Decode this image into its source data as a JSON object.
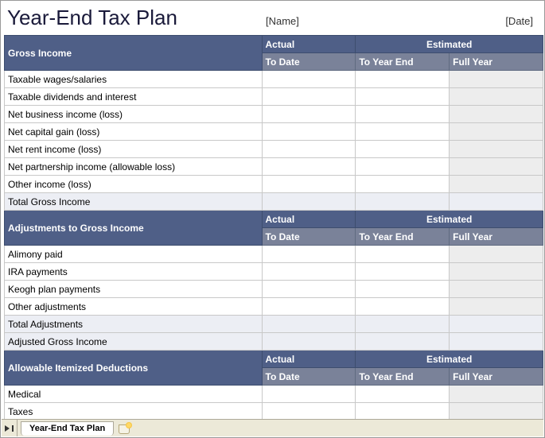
{
  "title": "Year-End Tax Plan",
  "placeholders": {
    "name": "[Name]",
    "date": "[Date]"
  },
  "columns": {
    "actual": "Actual",
    "estimated": "Estimated",
    "to_date": "To Date",
    "to_year_end": "To Year End",
    "full_year": "Full Year"
  },
  "sections": [
    {
      "title": "Gross Income",
      "rows": [
        "Taxable wages/salaries",
        "Taxable dividends and interest",
        "Net business income (loss)",
        "Net capital gain (loss)",
        "Net rent income (loss)",
        "Net partnership income (allowable loss)",
        "Other income (loss)"
      ],
      "totals": [
        "Total Gross Income"
      ]
    },
    {
      "title": "Adjustments to Gross Income",
      "rows": [
        "Alimony paid",
        "IRA payments",
        "Keogh plan payments",
        "Other adjustments"
      ],
      "totals": [
        "Total Adjustments",
        "Adjusted Gross Income"
      ]
    },
    {
      "title": "Allowable Itemized Deductions",
      "rows": [
        "Medical",
        "Taxes"
      ],
      "totals": []
    }
  ],
  "sheet_tab": "Year-End Tax Plan"
}
